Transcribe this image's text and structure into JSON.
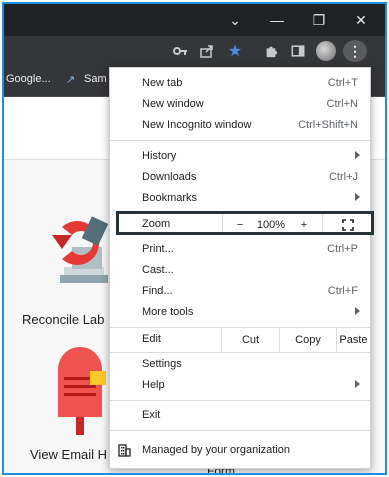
{
  "window": {
    "minimize_glyph": "—",
    "restore_glyph": "❐",
    "close_glyph": "✕",
    "dropdown_glyph": "⌄"
  },
  "toolbar": {
    "icons": [
      "key-icon",
      "share-icon",
      "star-icon",
      "extensions-icon",
      "side-panel-icon",
      "profile-avatar",
      "more-menu-icon"
    ],
    "accent_color": "#4d8fe8"
  },
  "bookmarks": {
    "item1": "Google...",
    "item2": "Sam"
  },
  "page": {
    "app1_label": "Reconcile Lab",
    "app2_label": "View Email H",
    "app3_label": "Form"
  },
  "menu": {
    "new_tab": "New tab",
    "new_tab_sc": "Ctrl+T",
    "new_window": "New window",
    "new_window_sc": "Ctrl+N",
    "incognito": "New Incognito window",
    "incognito_sc": "Ctrl+Shift+N",
    "history": "History",
    "downloads": "Downloads",
    "downloads_sc": "Ctrl+J",
    "bookmarks": "Bookmarks",
    "zoom_label": "Zoom",
    "zoom_minus": "−",
    "zoom_value": "100%",
    "zoom_plus": "+",
    "print": "Print...",
    "print_sc": "Ctrl+P",
    "cast": "Cast...",
    "find": "Find...",
    "find_sc": "Ctrl+F",
    "more_tools": "More tools",
    "edit": "Edit",
    "cut": "Cut",
    "copy": "Copy",
    "paste": "Paste",
    "settings": "Settings",
    "help": "Help",
    "exit": "Exit",
    "managed": "Managed by your organization"
  }
}
